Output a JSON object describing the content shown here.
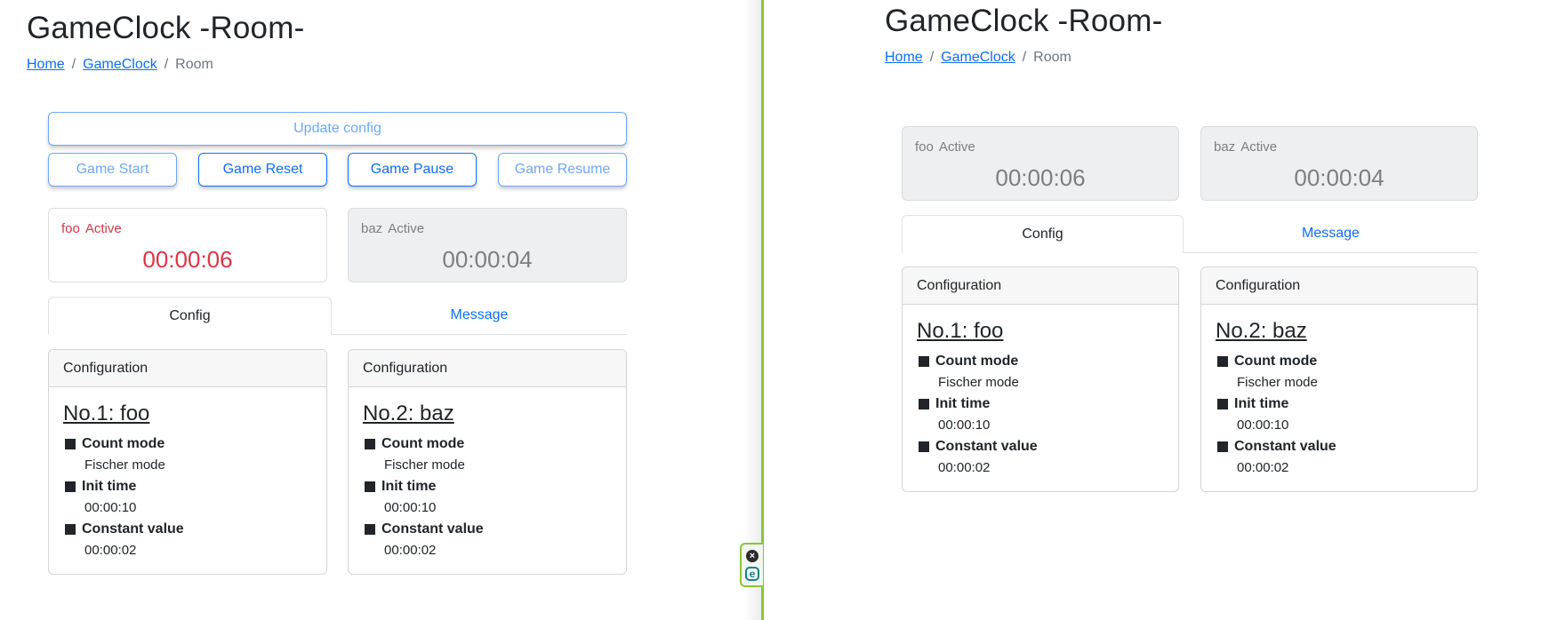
{
  "page": {
    "title": "GameClock -Room-",
    "breadcrumb": [
      {
        "label": "Home",
        "link": true
      },
      {
        "label": "GameClock",
        "link": true
      },
      {
        "label": "Room",
        "link": false
      }
    ],
    "breadcrumb_separator": "/"
  },
  "controls": {
    "update_config": "Update config",
    "game_start": "Game Start",
    "game_reset": "Game Reset",
    "game_pause": "Game Pause",
    "game_resume": "Game Resume"
  },
  "left_view": {
    "clocks": [
      {
        "name": "foo",
        "status": "Active",
        "time": "00:00:06",
        "state": "running"
      },
      {
        "name": "baz",
        "status": "Active",
        "time": "00:00:04",
        "state": "waiting"
      }
    ]
  },
  "right_view": {
    "clocks": [
      {
        "name": "foo",
        "status": "Active",
        "time": "00:00:06",
        "state": "waiting"
      },
      {
        "name": "baz",
        "status": "Active",
        "time": "00:00:04",
        "state": "waiting"
      }
    ]
  },
  "tabs": [
    {
      "label": "Config",
      "active": true
    },
    {
      "label": "Message",
      "active": false
    }
  ],
  "configs": [
    {
      "header": "Configuration",
      "title": "No.1: foo",
      "items": [
        {
          "label": "Count mode",
          "value": "Fischer mode"
        },
        {
          "label": "Init time",
          "value": "00:00:10"
        },
        {
          "label": "Constant value",
          "value": "00:00:02"
        }
      ]
    },
    {
      "header": "Configuration",
      "title": "No.2: baz",
      "items": [
        {
          "label": "Count mode",
          "value": "Fischer mode"
        },
        {
          "label": "Init time",
          "value": "00:00:10"
        },
        {
          "label": "Constant value",
          "value": "00:00:02"
        }
      ]
    }
  ],
  "extension_widget": {
    "close_icon": "close-circle-icon",
    "app_icon": "eset-e-icon"
  },
  "colors": {
    "accent": "#0d6efd",
    "accent_light": "#6ea8fe",
    "active_clock": "#dc3545",
    "divider": "#8cc43c"
  }
}
